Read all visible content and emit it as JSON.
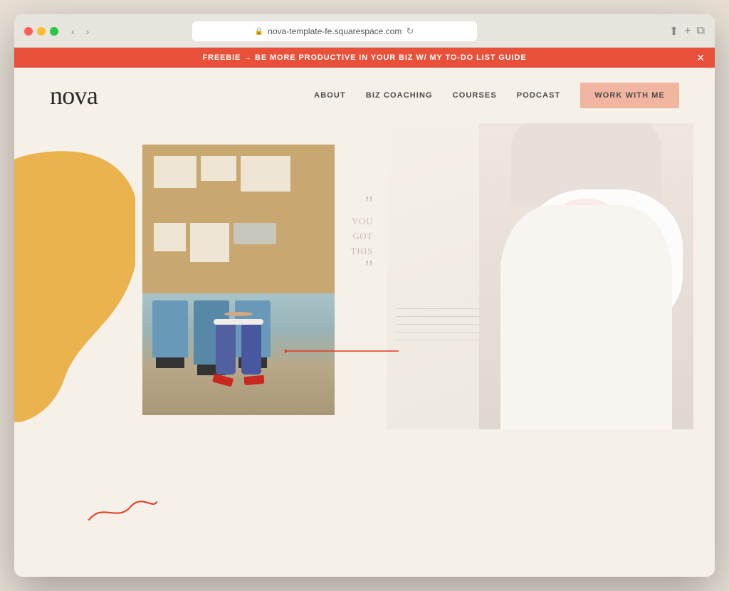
{
  "browser": {
    "url": "nova-template-fe.squarespace.com",
    "back_label": "‹",
    "forward_label": "›",
    "refresh_label": "↻",
    "share_label": "⬆",
    "new_tab_label": "+",
    "windows_label": "⧉",
    "window_controls_label": "⊞"
  },
  "banner": {
    "text": "FREEBIE → BE MORE PRODUCTIVE IN YOUR BIZ W/ MY TO-DO LIST GUIDE",
    "close_label": "✕"
  },
  "nav": {
    "logo": "nova",
    "links": [
      {
        "label": "ABOUT",
        "id": "about"
      },
      {
        "label": "BIZ COACHING",
        "id": "biz-coaching"
      },
      {
        "label": "COURSES",
        "id": "courses"
      },
      {
        "label": "PODCAST",
        "id": "podcast"
      }
    ],
    "cta_label": "WORK WITH ME"
  },
  "quote": {
    "open_quote": "\"",
    "line1": "YOU",
    "line2": "GOT",
    "line3": "THIS",
    "close_quote": "\""
  },
  "decorative": {
    "blob_color": "#e8a832",
    "red_color": "#e83820",
    "line_color": "#e83820"
  }
}
